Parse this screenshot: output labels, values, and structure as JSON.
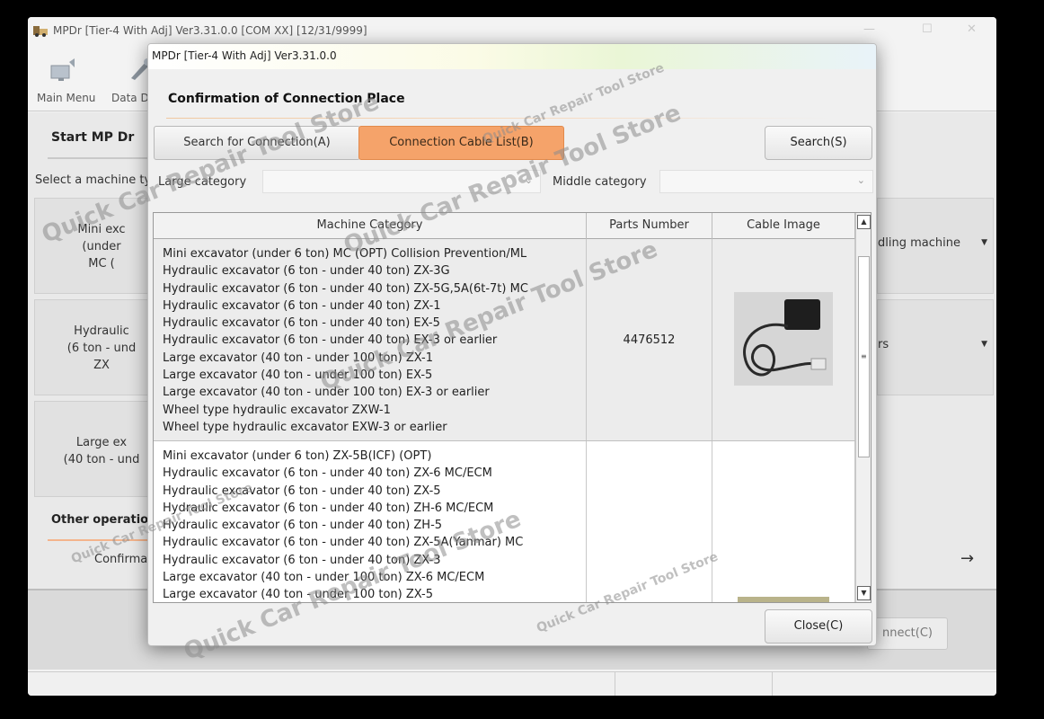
{
  "main_window": {
    "title": "MPDr [Tier-4 With Adj] Ver3.31.0.0 [COM XX] [12/31/9999]",
    "minimize": "—",
    "maximize": "☐",
    "close": "✕"
  },
  "toolbar": {
    "main_menu": "Main Menu",
    "data": "Data Di"
  },
  "start": {
    "heading": "Start MP Dr",
    "select_type": "Select a machine typ"
  },
  "machine_cards": [
    {
      "lines": [
        "Mini exc",
        "(under",
        "MC ("
      ]
    },
    {
      "lines": [
        "Hydraulic",
        "(6 ton - und",
        "ZX"
      ]
    },
    {
      "lines": [
        "Large ex",
        "(40 ton - und"
      ]
    }
  ],
  "right_cards": [
    {
      "label": "dling machine",
      "dropdown": "▼"
    },
    {
      "label": "rs",
      "dropdown": "▼"
    }
  ],
  "other": {
    "heading": "Other operation",
    "confirm": "Confirmat",
    "arrow": "→"
  },
  "connect_button": "nnect(C)",
  "dialog": {
    "title": "MPDr [Tier-4 With Adj] Ver3.31.0.0",
    "heading": "Confirmation of Connection Place",
    "tab_search": "Search for Connection(A)",
    "tab_cable": "Connection Cable List(B)",
    "search_button": "Search(S)",
    "large_category_label": "Large category",
    "middle_category_label": "Middle category",
    "dropdown_chevron": "⌄",
    "close_button": "Close(C)",
    "table": {
      "headers": [
        "Machine Category",
        "Parts Number",
        "Cable Image"
      ],
      "rows": [
        {
          "categories": [
            "Mini excavator (under 6 ton) MC (OPT) Collision Prevention/ML",
            "Hydraulic excavator (6 ton - under 40 ton) ZX-3G",
            "Hydraulic excavator (6 ton - under 40 ton) ZX-5G,5A(6t-7t) MC",
            "Hydraulic excavator (6 ton - under 40 ton) ZX-1",
            "Hydraulic excavator (6 ton - under 40 ton) EX-5",
            "Hydraulic excavator (6 ton - under 40 ton) EX-3 or earlier",
            "Large excavator (40 ton - under 100 ton) ZX-1",
            "Large excavator (40 ton - under 100 ton) EX-5",
            "Large excavator (40 ton - under 100 ton) EX-3 or earlier",
            "Wheel type hydraulic excavator ZXW-1",
            "Wheel type hydraulic excavator EXW-3 or earlier"
          ],
          "parts_number": "4476512"
        },
        {
          "categories": [
            "Mini excavator (under 6 ton) ZX-5B(ICF) (OPT)",
            "Hydraulic excavator (6 ton - under 40 ton) ZX-6 MC/ECM",
            "Hydraulic excavator (6 ton - under 40 ton) ZX-5",
            "Hydraulic excavator (6 ton - under 40 ton) ZH-6 MC/ECM",
            "Hydraulic excavator (6 ton - under 40 ton) ZH-5",
            "Hydraulic excavator (6 ton - under 40 ton) ZX-5A(Yanmar) MC",
            "Hydraulic excavator (6 ton - under 40 ton) ZX-3",
            "Large excavator (40 ton - under 100 ton) ZX-6 MC/ECM",
            "Large excavator (40 ton - under 100 ton) ZX-5"
          ],
          "parts_number": ""
        }
      ],
      "scroll_up": "▲",
      "scroll_down": "▼",
      "scroll_grip": "≡"
    }
  },
  "watermarks": [
    "Quick Car Repair Tool Store",
    "Quick Car Repair Tool Store",
    "Quick Car Repair Tool Store",
    "Quick Car Repair Tool Store",
    "Quick Car Repair Tool Store",
    "Quick Car Repair Tool Store",
    "Quick Car Repair Tool Store"
  ],
  "colors": {
    "active_tab": "#f5a36a",
    "accent_line": "#f4b48c"
  }
}
